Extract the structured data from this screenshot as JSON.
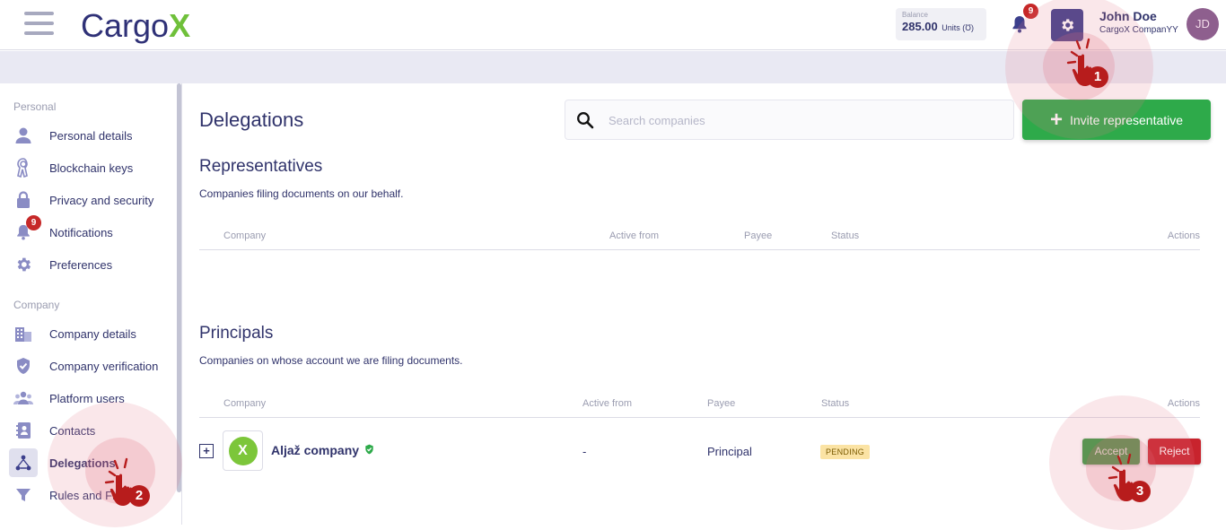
{
  "header": {
    "logo_text": "Cargo",
    "logo_accent": "X",
    "balance_label": "Balance",
    "balance_value": "285.00",
    "balance_unit": "Units (Ʊ)",
    "notification_count": "9",
    "user_name": "John Doe",
    "user_company": "CargoX CompanYY",
    "avatar_initials": "JD"
  },
  "sidebar": {
    "sections": [
      "Personal",
      "Company"
    ],
    "personal_items": [
      {
        "label": "Personal details",
        "icon": "person-icon"
      },
      {
        "label": "Blockchain keys",
        "icon": "key-icon"
      },
      {
        "label": "Privacy and security",
        "icon": "lock-icon"
      },
      {
        "label": "Notifications",
        "icon": "bell-icon",
        "badge": "9"
      },
      {
        "label": "Preferences",
        "icon": "gear-icon"
      }
    ],
    "company_items": [
      {
        "label": "Company details",
        "icon": "building-icon"
      },
      {
        "label": "Company verification",
        "icon": "shield-check-icon"
      },
      {
        "label": "Platform users",
        "icon": "users-icon"
      },
      {
        "label": "Contacts",
        "icon": "contacts-icon"
      },
      {
        "label": "Delegations",
        "icon": "delegation-icon",
        "active": true
      },
      {
        "label": "Rules and Filters",
        "icon": "filter-icon"
      }
    ]
  },
  "main": {
    "title": "Delegations",
    "search_placeholder": "Search companies",
    "invite_label": "Invite representative",
    "representatives": {
      "title": "Representatives",
      "subtitle": "Companies filing documents on our behalf.",
      "columns": [
        "Company",
        "Active from",
        "Payee",
        "Status",
        "Actions"
      ]
    },
    "principals": {
      "title": "Principals",
      "subtitle": "Companies on whose account we are filing documents.",
      "columns": [
        "Company",
        "Active from",
        "Payee",
        "Status",
        "Actions"
      ],
      "rows": [
        {
          "company": "Aljaž company",
          "active_from": "-",
          "payee": "Principal",
          "status": "PENDING",
          "accept": "Accept",
          "reject": "Reject"
        }
      ]
    }
  },
  "annotations": {
    "step1": "1",
    "step2": "2",
    "step3": "3"
  },
  "colors": {
    "brand": "#30336b",
    "accent_green": "#2eaa4a",
    "danger": "#c8232d"
  }
}
